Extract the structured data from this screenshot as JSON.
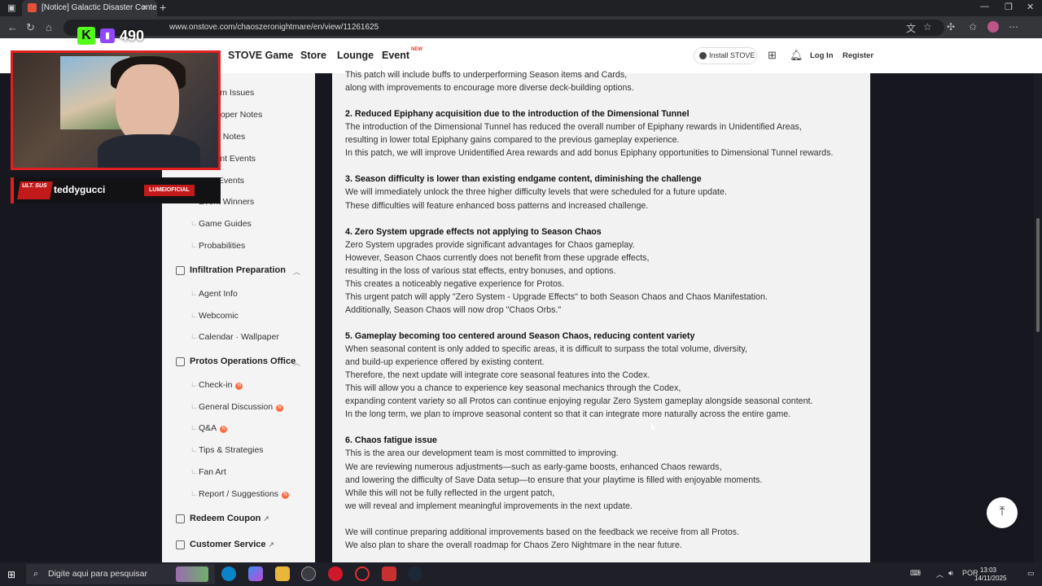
{
  "browser": {
    "tab_title": "[Notice] Galactic Disaster Conten",
    "tab_close": "×",
    "new_tab": "+",
    "url": "www.onstove.com/chaoszeronightmare/en/view/11261625"
  },
  "site_header": {
    "nav": [
      "STOVE Game",
      "Store",
      "Lounge",
      "Event"
    ],
    "event_badge": "NEW",
    "install_label": "Install STOVE",
    "login": "Log In",
    "register": "Register"
  },
  "sidebar": {
    "items_top": [
      {
        "label": "System Issues"
      },
      {
        "label": "Developer Notes"
      },
      {
        "label": "Patch Notes"
      },
      {
        "label": "Current Events"
      },
      {
        "label": "Past Events"
      },
      {
        "label": "Event Winners"
      },
      {
        "label": "Game Guides"
      },
      {
        "label": "Probabilities"
      }
    ],
    "section_infiltration": "Infiltration Preparation",
    "items_infiltration": [
      {
        "label": "Agent Info"
      },
      {
        "label": "Webcomic"
      },
      {
        "label": "Calendar · Wallpaper"
      }
    ],
    "section_protos": "Protos Operations Office",
    "items_protos": [
      {
        "label": "Check-in",
        "badge": "N"
      },
      {
        "label": "General Discussion",
        "badge": "N"
      },
      {
        "label": "Q&A",
        "badge": "N"
      },
      {
        "label": "Tips & Strategies",
        "badge": ""
      },
      {
        "label": "Fan Art",
        "badge": ""
      },
      {
        "label": "Report / Suggestions",
        "badge": "N"
      }
    ],
    "redeem": "Redeem Coupon",
    "customer_service": "Customer Service"
  },
  "article": {
    "lines": [
      {
        "text": "This patch will include buffs to underperforming Season items and Cards,",
        "bold": false
      },
      {
        "text": "along with improvements to encourage more diverse deck-building options.",
        "bold": false
      },
      {
        "text": "",
        "bold": false
      },
      {
        "text": "2. Reduced Epiphany acquisition due to the introduction of the Dimensional Tunnel",
        "bold": true
      },
      {
        "text": "The introduction of the Dimensional Tunnel has reduced the overall number of Epiphany rewards in Unidentified Areas,",
        "bold": false
      },
      {
        "text": "resulting in lower total Epiphany gains compared to the previous gameplay experience.",
        "bold": false
      },
      {
        "text": "In this patch, we will improve Unidentified Area rewards and add bonus Epiphany opportunities to Dimensional Tunnel rewards.",
        "bold": false
      },
      {
        "text": "",
        "bold": false
      },
      {
        "text": "3. Season difficulty is lower than existing endgame content, diminishing the challenge",
        "bold": true
      },
      {
        "text": "We will immediately unlock the three higher difficulty levels that were scheduled for a future update.",
        "bold": false
      },
      {
        "text": "These difficulties will feature enhanced boss patterns and increased challenge.",
        "bold": false
      },
      {
        "text": "",
        "bold": false
      },
      {
        "text": "4. Zero System upgrade effects not applying to Season Chaos",
        "bold": true
      },
      {
        "text": "Zero System upgrades provide significant advantages for Chaos gameplay.",
        "bold": false
      },
      {
        "text": "However, Season Chaos currently does not benefit from these upgrade effects,",
        "bold": false
      },
      {
        "text": "resulting in the loss of various stat effects, entry bonuses, and options.",
        "bold": false
      },
      {
        "text": "This creates a noticeably negative experience for Protos.",
        "bold": false
      },
      {
        "text": "This urgent patch will apply \"Zero System - Upgrade Effects\" to both Season Chaos and Chaos Manifestation.",
        "bold": false
      },
      {
        "text": "Additionally, Season Chaos will now drop \"Chaos Orbs.\"",
        "bold": false
      },
      {
        "text": "",
        "bold": false
      },
      {
        "text": "5. Gameplay becoming too centered around Season Chaos, reducing content variety",
        "bold": true
      },
      {
        "text": "When seasonal content is only added to specific areas, it is difficult to surpass the total volume, diversity,",
        "bold": false
      },
      {
        "text": "and build-up experience offered by existing content.",
        "bold": false
      },
      {
        "text": "Therefore, the next update will integrate core seasonal features into the Codex.",
        "bold": false
      },
      {
        "text": "This will allow you a chance to experience key seasonal mechanics through the Codex,",
        "bold": false
      },
      {
        "text": "expanding content variety so all Protos can continue enjoying regular Zero System gameplay alongside seasonal content.",
        "bold": false
      },
      {
        "text": "In the long term, we plan to improve seasonal content so that it can integrate more naturally across the entire game.",
        "bold": false
      },
      {
        "text": "",
        "bold": false
      },
      {
        "text": "6. Chaos fatigue issue",
        "bold": true
      },
      {
        "text": "This is the area our development team is most committed to improving.",
        "bold": false
      },
      {
        "text": "We are reviewing numerous adjustments—such as early-game boosts, enhanced Chaos rewards,",
        "bold": false
      },
      {
        "text": "and lowering the difficulty of Save Data setup—to ensure that your playtime is filled with enjoyable moments.",
        "bold": false
      },
      {
        "text": "While this will not be fully reflected in the urgent patch,",
        "bold": false
      },
      {
        "text": "we will reveal and implement meaningful improvements in the next update.",
        "bold": false
      },
      {
        "text": "",
        "bold": false
      },
      {
        "text": "We will continue preparing additional improvements based on the feedback we receive from all Protos.",
        "bold": false
      },
      {
        "text": "We also plan to share the overall roadmap for Chaos Zero Nightmare in the near future.",
        "bold": false
      }
    ]
  },
  "overlay": {
    "viewer_count": "490",
    "kick_letter": "K",
    "streamer_name": "teddygucci",
    "team_tag": "ULT. SUS",
    "sponsor": "LUMEIOFICIAL"
  },
  "taskbar": {
    "search_placeholder": "Digite aqui para pesquisar",
    "lang": "POR",
    "time": "13:03",
    "date": "14/11/2025"
  }
}
